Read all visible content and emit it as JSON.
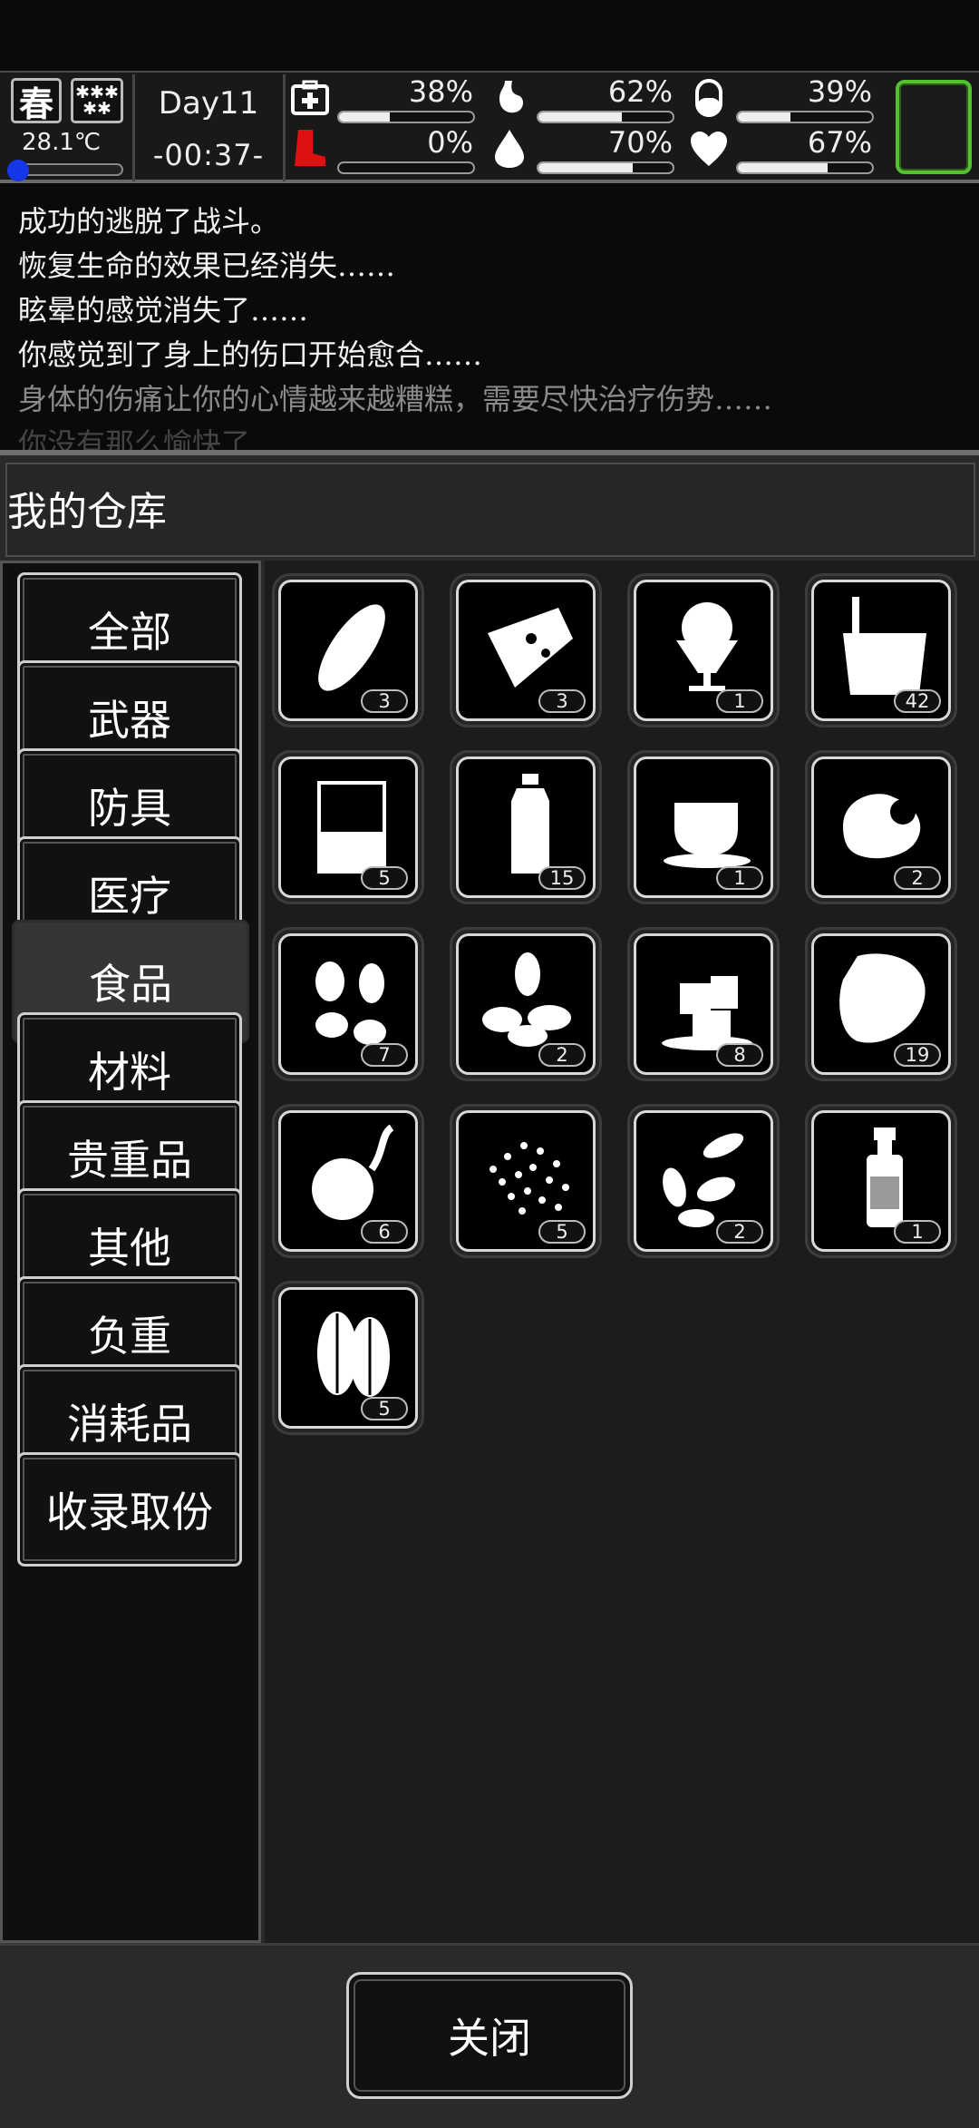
{
  "hud": {
    "season": "春",
    "weather_icon": "snow-icon",
    "temperature": "28.1℃",
    "day": "Day11",
    "time": "-00:37-",
    "stats": [
      {
        "name": "health",
        "icon": "medkit-icon",
        "value": "38%",
        "level": 0.38
      },
      {
        "name": "hunger",
        "icon": "stomach-icon",
        "value": "62%",
        "level": 0.62
      },
      {
        "name": "energy",
        "icon": "pill-icon",
        "value": "39%",
        "level": 0.39
      },
      {
        "name": "injury",
        "icon": "boot-icon",
        "value": "0%",
        "level": 0.0
      },
      {
        "name": "thirst",
        "icon": "water-drop-icon",
        "value": "70%",
        "level": 0.7
      },
      {
        "name": "mood",
        "icon": "heart-icon",
        "value": "67%",
        "level": 0.67
      }
    ],
    "equip_slot_color": "#52c22e"
  },
  "log": [
    "成功的逃脱了战斗。",
    "恢复生命的效果已经消失……",
    "眩晕的感觉消失了……",
    "你感觉到了身上的伤口开始愈合……",
    "身体的伤痛让你的心情越来越糟糕，需要尽快治疗伤势……",
    "你没有那么愉快了……"
  ],
  "warehouse": {
    "title": "我的仓库",
    "categories": [
      "全部",
      "武器",
      "防具",
      "医疗",
      "食品",
      "材料",
      "贵重品",
      "其他",
      "负重",
      "消耗品",
      "收录取份"
    ],
    "active_category": "食品",
    "items": [
      {
        "icon": "bread-icon",
        "count": "3"
      },
      {
        "icon": "pizza-slice-icon",
        "count": "3"
      },
      {
        "icon": "sundae-icon",
        "count": "1"
      },
      {
        "icon": "bucket-icon",
        "count": "42"
      },
      {
        "icon": "beaker-icon",
        "count": "5"
      },
      {
        "icon": "water-bottle-icon",
        "count": "15"
      },
      {
        "icon": "coffee-cup-icon",
        "count": "1"
      },
      {
        "icon": "egg-icon",
        "count": "2"
      },
      {
        "icon": "peanuts-icon",
        "count": "7"
      },
      {
        "icon": "almonds-icon",
        "count": "2"
      },
      {
        "icon": "ice-cubes-icon",
        "count": "8"
      },
      {
        "icon": "meat-icon",
        "count": "19"
      },
      {
        "icon": "sprouting-potato-icon",
        "count": "6"
      },
      {
        "icon": "seeds-icon",
        "count": "5"
      },
      {
        "icon": "sunflower-seeds-icon",
        "count": "2"
      },
      {
        "icon": "sauce-bottle-icon",
        "count": "1"
      },
      {
        "icon": "beans-icon",
        "count": "5"
      }
    ],
    "close_label": "关闭"
  }
}
